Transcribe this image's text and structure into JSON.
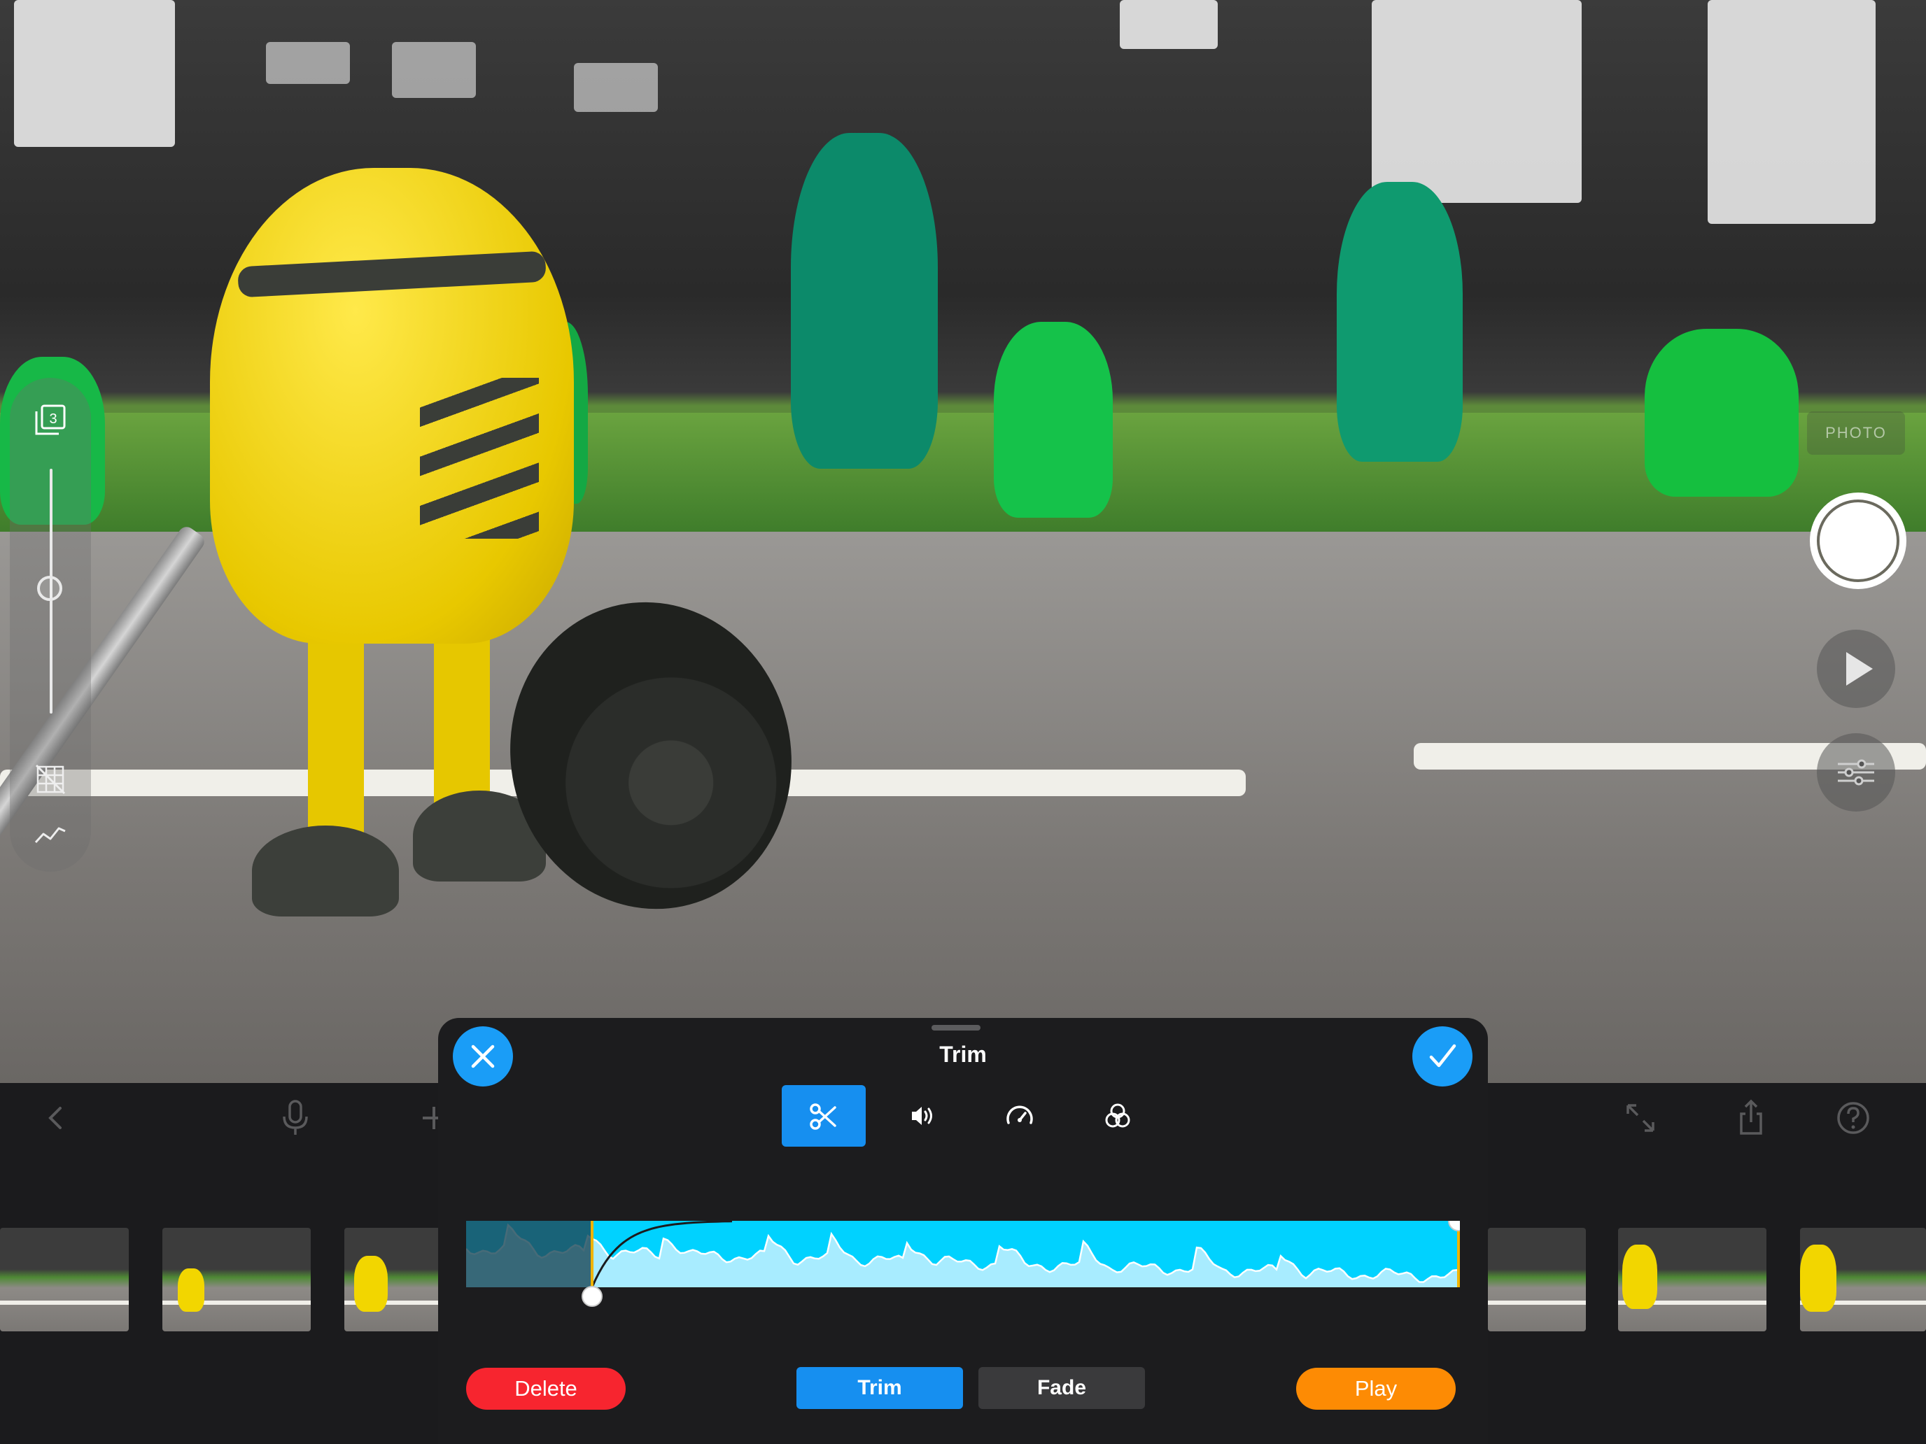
{
  "camera": {
    "layer_count": "3",
    "photo_label": "PHOTO",
    "icons": [
      "layers-icon",
      "slider-knob",
      "grid-off-icon",
      "graph-icon",
      "shutter-button",
      "play-icon",
      "settings-sliders-icon"
    ]
  },
  "toolbar": {
    "icons": [
      "back-chevron-icon",
      "microphone-icon",
      "add-icon",
      "fullscreen-icon",
      "share-icon",
      "help-icon"
    ]
  },
  "trim_panel": {
    "title": "Trim",
    "cancel_icon": "close-icon",
    "confirm_icon": "checkmark-icon",
    "tools": [
      {
        "name": "scissors-icon",
        "active": true
      },
      {
        "name": "speaker-icon",
        "active": false
      },
      {
        "name": "speedometer-icon",
        "active": false
      },
      {
        "name": "color-circles-icon",
        "active": false
      }
    ],
    "trim_start_fraction": 0.127,
    "trim_end_fraction": 1.0,
    "buttons": {
      "delete": "Delete",
      "trim": "Trim",
      "fade": "Fade",
      "play": "Play"
    },
    "selected_mode": "Trim"
  },
  "colors": {
    "accent_blue": "#1a9df7",
    "waveform_cyan": "#00d2ff",
    "delete_red": "#f7252f",
    "play_orange": "#fd8b04",
    "trim_handle_yellow": "#f0b400"
  },
  "filmstrip": {
    "frame_count_visible": 7
  }
}
